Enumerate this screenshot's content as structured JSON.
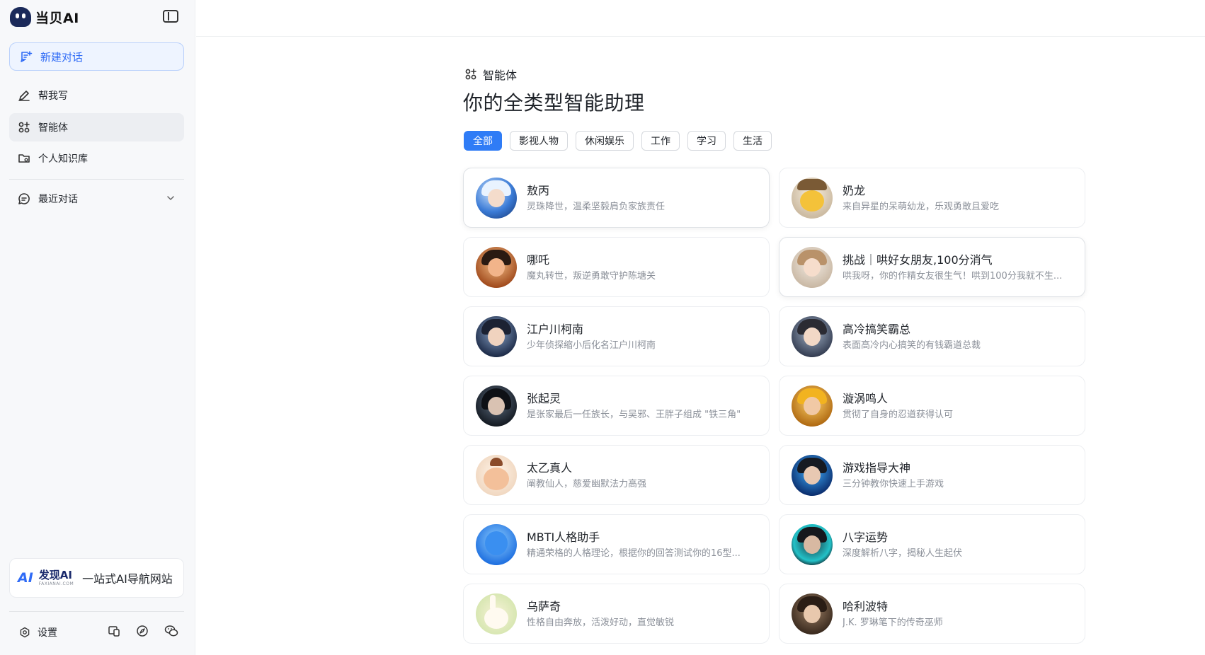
{
  "app": {
    "brand": "当贝AI"
  },
  "sidebar": {
    "new_chat": "新建对话",
    "items": [
      {
        "label": "帮我写"
      },
      {
        "label": "智能体"
      },
      {
        "label": "个人知识库"
      }
    ],
    "recent": "最近对话",
    "promo": {
      "logo_text": "发现AI",
      "logo_sub": "FAXIANAI.COM",
      "tagline": "一站式AI导航网站"
    },
    "settings": "设置"
  },
  "main": {
    "section_label": "智能体",
    "title": "你的全类型智能助理",
    "tabs": [
      "全部",
      "影视人物",
      "休闲娱乐",
      "工作",
      "学习",
      "生活"
    ],
    "active_tab": "全部",
    "agents": [
      {
        "name": "敖丙",
        "desc": "灵珠降世，温柔坚毅肩负家族责任"
      },
      {
        "name": "奶龙",
        "desc": "来自异星的呆萌幼龙，乐观勇敢且爱吃"
      },
      {
        "name": "哪吒",
        "desc": "魔丸转世，叛逆勇敢守护陈塘关"
      },
      {
        "name": "挑战｜哄好女朋友,100分消气",
        "desc": "哄我呀，你的作精女友很生气！哄到100分我就不生..."
      },
      {
        "name": "江户川柯南",
        "desc": "少年侦探缩小后化名江户川柯南"
      },
      {
        "name": "高冷搞笑霸总",
        "desc": "表面高冷内心搞笑的有钱霸道总裁"
      },
      {
        "name": "张起灵",
        "desc": "是张家最后一任族长，与吴邪、王胖子组成 \"铁三角\""
      },
      {
        "name": "漩涡鸣人",
        "desc": "贯彻了自身的忍道获得认可"
      },
      {
        "name": "太乙真人",
        "desc": "阐教仙人，慈爱幽默法力高强"
      },
      {
        "name": "游戏指导大神",
        "desc": "三分钟教你快速上手游戏"
      },
      {
        "name": "MBTI人格助手",
        "desc": "精通荣格的人格理论，根据你的回答测试你的16型..."
      },
      {
        "name": "八字运势",
        "desc": "深度解析八字，揭秘人生起伏"
      },
      {
        "name": "乌萨奇",
        "desc": "性格自由奔放，活泼好动，直觉敏锐"
      },
      {
        "name": "哈利波特",
        "desc": "J.K. 罗琳笔下的传奇巫师"
      }
    ]
  }
}
